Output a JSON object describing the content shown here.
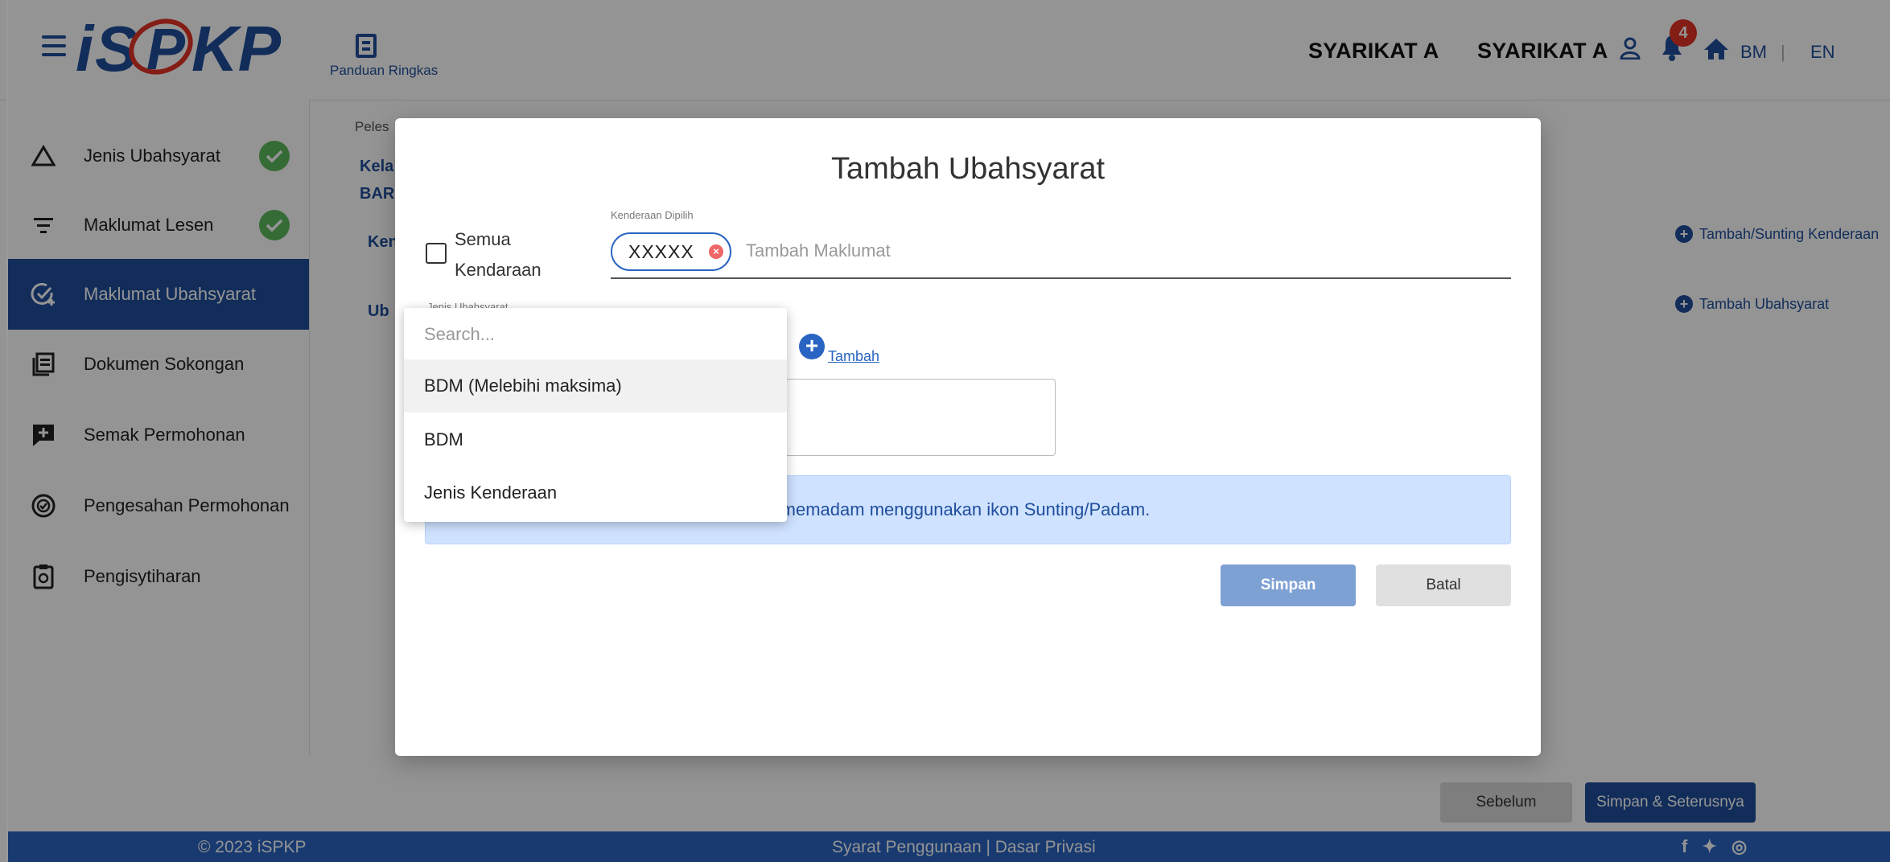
{
  "header": {
    "guide_label": "Panduan Ringkas",
    "company_1": "SYARIKAT A",
    "company_2": "SYARIKAT A",
    "notification_count": "4",
    "lang_bm": "BM",
    "lang_sep": "|",
    "lang_en": "EN",
    "logo_text": "iSPKP"
  },
  "sidebar": {
    "items": [
      {
        "label": "Jenis Ubahsyarat",
        "icon": "triangle-icon",
        "completed": true
      },
      {
        "label": "Maklumat Lesen",
        "icon": "filter-icon",
        "completed": true
      },
      {
        "label": "Maklumat Ubahsyarat",
        "icon": "check-plus-icon",
        "active": true
      },
      {
        "label": "Dokumen Sokongan",
        "icon": "document-icon"
      },
      {
        "label": "Semak Permohonan",
        "icon": "comment-plus-icon"
      },
      {
        "label": "Pengesahan Permohonan",
        "icon": "badge-check-icon"
      },
      {
        "label": "Pengisytiharan",
        "icon": "clipboard-icon"
      }
    ]
  },
  "main": {
    "breadcrumb_fragment": "Peles",
    "line1_fragment": "Kela",
    "line2_fragment": "BAR",
    "kend_fragment": "Ken",
    "ubah_fragment": "Ub",
    "link_kenderaan": "Tambah/Sunting Kenderaan",
    "link_ubahsyarat": "Tambah Ubahsyarat",
    "btn_prev": "Sebelum",
    "btn_next": "Simpan & Seterusnya"
  },
  "modal": {
    "title": "Tambah Ubahsyarat",
    "semua_label_1": "Semua",
    "semua_label_2": "Kendaraan",
    "kenderaan_label": "Kenderaan Dipilih",
    "chip_value": "XXXXX",
    "kenderaan_placeholder": "Tambah Maklumat",
    "jenis_label": "Jenis Ubahsyarat",
    "add_link": "Tambah",
    "info_text": "ar/memadam menggunakan ikon Sunting/Padam.",
    "save_label": "Simpan",
    "cancel_label": "Batal"
  },
  "dropdown": {
    "search_placeholder": "Search...",
    "options": [
      "BDM (Melebihi maksima)",
      "BDM",
      "Jenis Kenderaan"
    ]
  },
  "footer": {
    "copyright": "© 2023 iSPKP",
    "links": "Syarat Penggunaan | Dasar Privasi",
    "social": "f ✦ ◎"
  },
  "colors": {
    "primary": "#1f4f9c",
    "footer": "#2a64c2",
    "success": "#5cb85c",
    "badge": "#e33225",
    "info_bg": "#cfe2ff"
  }
}
